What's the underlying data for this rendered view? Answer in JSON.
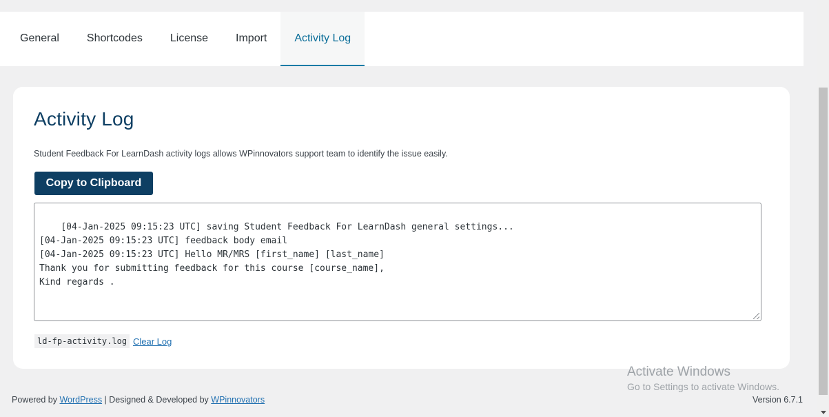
{
  "tabs": {
    "general": "General",
    "shortcodes": "Shortcodes",
    "license": "License",
    "import": "Import",
    "activity_log": "Activity Log",
    "active": "Activity Log"
  },
  "card": {
    "title": "Activity Log",
    "description": "Student Feedback For LearnDash activity logs allows WPinnovators support team to identify the issue easily.",
    "copy_button": "Copy to Clipboard",
    "log_text": "[04-Jan-2025 09:15:23 UTC] saving Student Feedback For LearnDash general settings...\n[04-Jan-2025 09:15:23 UTC] feedback body email\n[04-Jan-2025 09:15:23 UTC] Hello MR/MRS [first_name] [last_name]\nThank you for submitting feedback for this course [course_name],\nKind regards .",
    "log_file": "ld-fp-activity.log",
    "clear_link": "Clear Log"
  },
  "watermark": {
    "line1": "Activate Windows",
    "line2": "Go to Settings to activate Windows."
  },
  "footer": {
    "powered_by": "Powered by ",
    "wordpress_link": "WordPress",
    "designed_by": " | Designed & Developed by ",
    "wpinnovators_link": "WPinnovators",
    "version": "Version 6.7.1"
  },
  "colors": {
    "brand": "#0e3f63",
    "active_tab": "#0b6e99",
    "link": "#2271b1",
    "page_bg": "#f0f0f1"
  }
}
